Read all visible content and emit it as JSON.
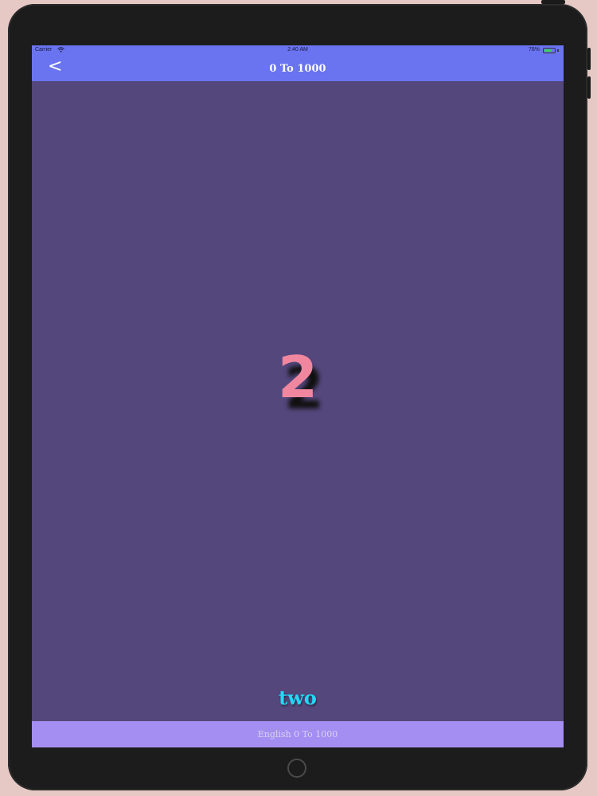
{
  "status_bar": {
    "carrier": "Carrier",
    "wifi_icon": "wifi-icon",
    "time": "2:40 AM",
    "battery_text": "78%",
    "battery_level": 0.78,
    "battery_color": "#3bd15a"
  },
  "nav": {
    "back_icon": "chevron-left-icon",
    "back_glyph": "<",
    "title": "0 To 1000",
    "background": "#6a74f1"
  },
  "content": {
    "number": "2",
    "word": "two",
    "number_color": "#f0879f",
    "word_color": "#21d9f5",
    "background": "#54477c"
  },
  "footer": {
    "label": "English 0 To 1000",
    "background": "#a48ef2"
  }
}
